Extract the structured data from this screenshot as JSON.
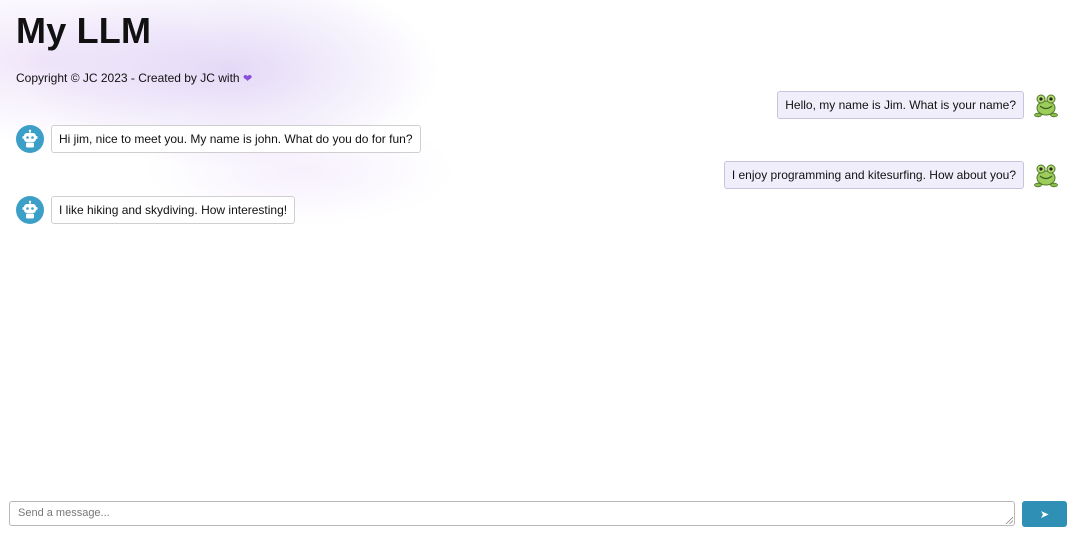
{
  "header": {
    "title": "My LLM",
    "copyright_text": "Copyright © JC 2023 - Created by JC with",
    "heart_glyph": "❤"
  },
  "messages": [
    {
      "role": "user",
      "text": "Hello, my name is Jim. What is your name?",
      "avatar_icon": "frog-icon"
    },
    {
      "role": "bot",
      "text": "Hi jim, nice to meet you. My name is john. What do you do for fun?",
      "avatar_icon": "robot-icon"
    },
    {
      "role": "user",
      "text": "I enjoy programming and kitesurfing. How about you?",
      "avatar_icon": "frog-icon"
    },
    {
      "role": "bot",
      "text": "I like hiking and skydiving. How interesting!",
      "avatar_icon": "robot-icon"
    }
  ],
  "composer": {
    "placeholder": "Send a message...",
    "value": "",
    "send_glyph": "➤",
    "send_icon": "send-icon"
  },
  "colors": {
    "accent": "#2f8fb5",
    "bot_avatar_bg": "#3c9fc8",
    "user_bubble_bg": "#f1eefb",
    "heart": "#8a4fd8"
  }
}
